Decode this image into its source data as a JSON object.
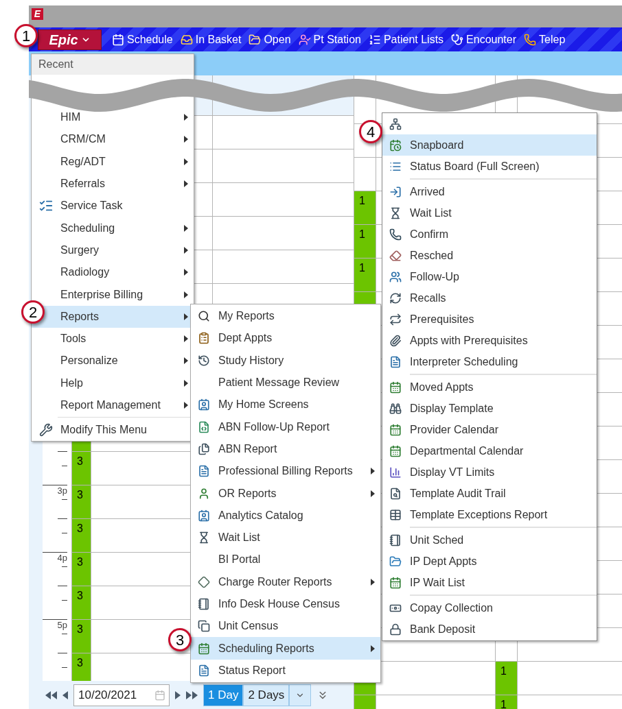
{
  "logo": "E",
  "epic_button": {
    "label": "Epic"
  },
  "toolbar": [
    {
      "label": "Schedule"
    },
    {
      "label": "In Basket"
    },
    {
      "label": "Open"
    },
    {
      "label": "Pt Station"
    },
    {
      "label": "Patient Lists"
    },
    {
      "label": "Encounter"
    },
    {
      "label": "Telep"
    }
  ],
  "main_menu": {
    "header": "Recent",
    "items": [
      {
        "label": "HIM",
        "submenu": true,
        "selected": false
      },
      {
        "label": "CRM/CM",
        "submenu": true,
        "selected": false
      },
      {
        "label": "Reg/ADT",
        "submenu": true,
        "selected": false
      },
      {
        "label": "Referrals",
        "submenu": true,
        "selected": false
      },
      {
        "label": "Service Task",
        "submenu": false,
        "selected": false
      },
      {
        "label": "Scheduling",
        "submenu": true,
        "selected": false
      },
      {
        "label": "Surgery",
        "submenu": true,
        "selected": false
      },
      {
        "label": "Radiology",
        "submenu": true,
        "selected": false
      },
      {
        "label": "Enterprise Billing",
        "submenu": true,
        "selected": false
      },
      {
        "label": "Reports",
        "submenu": true,
        "selected": true
      },
      {
        "label": "Tools",
        "submenu": true,
        "selected": false
      },
      {
        "label": "Personalize",
        "submenu": true,
        "selected": false
      },
      {
        "label": "Help",
        "submenu": true,
        "selected": false
      },
      {
        "label": "Report Management",
        "submenu": true,
        "selected": false
      }
    ],
    "footer": {
      "label": "Modify This Menu"
    }
  },
  "reports_menu": {
    "items": [
      {
        "label": "My Reports",
        "submenu": false,
        "selected": false
      },
      {
        "label": "Dept Appts",
        "submenu": false,
        "selected": false
      },
      {
        "label": "Study History",
        "submenu": false,
        "selected": false
      },
      {
        "label": "Patient Message Review",
        "submenu": false,
        "selected": false
      },
      {
        "label": "My Home Screens",
        "submenu": false,
        "selected": false
      },
      {
        "label": "ABN Follow-Up Report",
        "submenu": false,
        "selected": false
      },
      {
        "label": "ABN Report",
        "submenu": false,
        "selected": false
      },
      {
        "label": "Professional Billing Reports",
        "submenu": true,
        "selected": false
      },
      {
        "label": "OR Reports",
        "submenu": true,
        "selected": false
      },
      {
        "label": "Analytics Catalog",
        "submenu": false,
        "selected": false
      },
      {
        "label": "Wait List",
        "submenu": false,
        "selected": false
      },
      {
        "label": "BI Portal",
        "submenu": false,
        "selected": false
      },
      {
        "label": "Charge Router Reports",
        "submenu": true,
        "selected": false
      },
      {
        "label": "Info Desk House Census",
        "submenu": false,
        "selected": false
      },
      {
        "label": "Unit Census",
        "submenu": false,
        "selected": false
      },
      {
        "label": "Scheduling Reports",
        "submenu": true,
        "selected": true
      },
      {
        "label": "Status Report",
        "submenu": false,
        "selected": false
      }
    ]
  },
  "scheduling_reports_menu": {
    "items": [
      {
        "label": "Snapboard",
        "selected": true
      },
      {
        "label": "Status Board (Full Screen)",
        "selected": false
      },
      {
        "label": "Arrived",
        "selected": false,
        "separator_before": true
      },
      {
        "label": "Wait List",
        "selected": false
      },
      {
        "label": "Confirm",
        "selected": false
      },
      {
        "label": "Resched",
        "selected": false
      },
      {
        "label": "Follow-Up",
        "selected": false
      },
      {
        "label": "Recalls",
        "selected": false
      },
      {
        "label": "Prerequisites",
        "selected": false
      },
      {
        "label": "Appts with Prerequisites",
        "selected": false
      },
      {
        "label": "Interpreter Scheduling",
        "selected": false
      },
      {
        "label": "Moved Appts",
        "selected": false,
        "separator_before": true
      },
      {
        "label": "Display Template",
        "selected": false
      },
      {
        "label": "Provider Calendar",
        "selected": false
      },
      {
        "label": "Departmental Calendar",
        "selected": false
      },
      {
        "label": "Display VT Limits",
        "selected": false
      },
      {
        "label": "Template Audit Trail",
        "selected": false
      },
      {
        "label": "Template Exceptions Report",
        "selected": false
      },
      {
        "label": "Unit Sched",
        "selected": false,
        "separator_before": true
      },
      {
        "label": "IP Dept Appts",
        "selected": false
      },
      {
        "label": "IP Wait List",
        "selected": false
      },
      {
        "label": "Copay Collection",
        "selected": false,
        "separator_before": true
      },
      {
        "label": "Bank Deposit",
        "selected": false
      }
    ]
  },
  "schedule": {
    "time_labels": [
      "3p",
      "4p",
      "5p"
    ],
    "columns": [
      {
        "blocks": [
          {
            "label": "3"
          },
          {
            "label": "3"
          },
          {
            "label": "3"
          },
          {
            "label": "3"
          },
          {
            "label": "3"
          },
          {
            "label": "3"
          },
          {
            "label": "3"
          }
        ]
      },
      {
        "blocks": [
          {
            "label": "1"
          },
          {
            "label": "1"
          },
          {
            "label": "1"
          }
        ]
      },
      {
        "blocks": [
          {
            "label": "1"
          },
          {
            "label": "1"
          }
        ]
      }
    ]
  },
  "date_nav": {
    "date": "10/20/2021",
    "views": [
      {
        "label": "1 Day",
        "selected": true
      },
      {
        "label": "2 Days",
        "selected": false
      }
    ]
  },
  "callouts": [
    "1",
    "2",
    "3",
    "4"
  ]
}
